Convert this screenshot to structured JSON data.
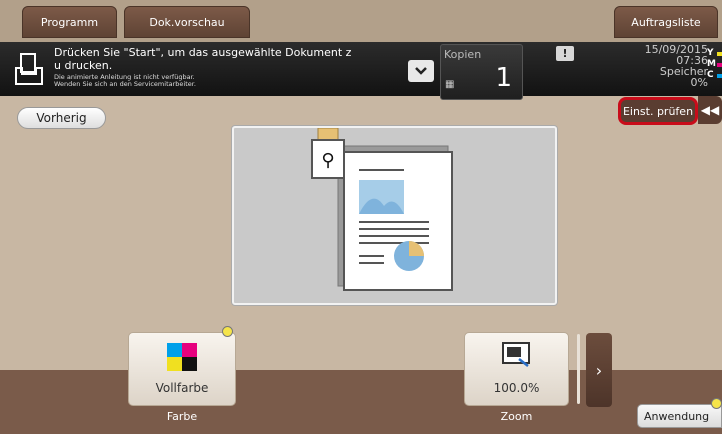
{
  "tabs": {
    "programm": "Programm",
    "vorschau": "Dok.vorschau",
    "auftragsliste": "Auftragsliste"
  },
  "status": {
    "message_line1": "Drücken Sie \"Start\", um das ausgewählte Dokument z",
    "message_line2": "u drucken.",
    "hint_line1": "Die animierte Anleitung ist nicht verfügbar.",
    "hint_line2": "Wenden Sie sich an den Servicemitarbeiter.",
    "kopien_label": "Kopien",
    "kopien_value": "1",
    "date": "15/09/2015",
    "time": "07:36",
    "speicher_label": "Speicher",
    "speicher_value": "0%",
    "toner_y": "Y",
    "toner_m": "M",
    "toner_c": "C",
    "warning_symbol": "!"
  },
  "buttons": {
    "vorherig": "Vorherig",
    "einst_pruefen": "Einst. prüfen",
    "collapse_symbol": "◀◀",
    "next_symbol": "›",
    "anwendung": "Anwendung"
  },
  "functions": [
    {
      "value": "Vollfarbe",
      "caption": "Farbe",
      "icon": "color-squares-icon"
    },
    {
      "value": "100.0%",
      "caption": "Zoom",
      "icon": "zoom-icon"
    }
  ],
  "colors": {
    "accent_brown": "#5a3d31",
    "highlight_red": "#c80c1a",
    "toner_yellow": "#f0e020",
    "toner_magenta": "#e6007e",
    "toner_cyan": "#00a0e9",
    "indicator_yellow": "#f5e44a"
  }
}
